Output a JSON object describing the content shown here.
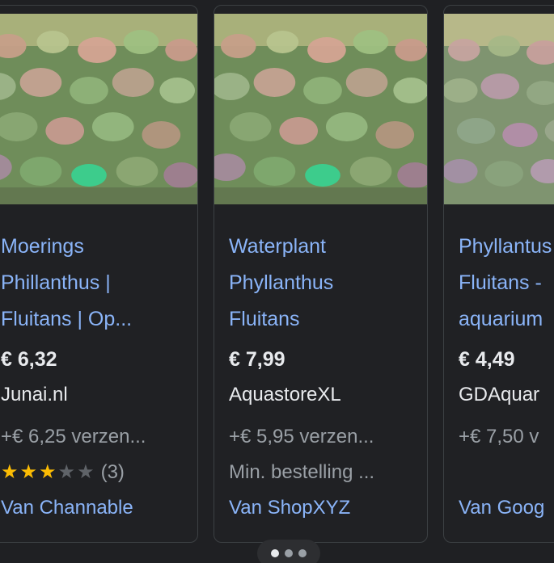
{
  "cards": [
    {
      "title_lines": [
        "Moerings",
        "Phillanthus |",
        "Fluitans | Op..."
      ],
      "price": "€ 6,32",
      "store": "Junai.nl",
      "shipping": "+€ 6,25 verzen...",
      "rating": {
        "value": 3,
        "max": 5,
        "count": "(3)"
      },
      "source": "Van Channable"
    },
    {
      "title_lines": [
        "Waterplant",
        "Phyllanthus",
        "Fluitans"
      ],
      "price": "€ 7,99",
      "store": "AquastoreXL",
      "shipping": "+€ 5,95 verzen...",
      "min_order": "Min. bestelling ...",
      "source": "Van ShopXYZ"
    },
    {
      "title_lines": [
        "Phyllantus",
        "Fluitans -",
        "aquarium"
      ],
      "price": "€ 4,49",
      "store": "GDAquar",
      "shipping": "+€ 7,50 v",
      "source": "Van Goog"
    }
  ],
  "pager": {
    "pages": 3,
    "active": 1
  },
  "colors": {
    "link": "#8ab4f8",
    "text": "#e8eaed",
    "muted": "#9aa0a6",
    "star": "#fbbc04",
    "card_bg": "#202124"
  }
}
